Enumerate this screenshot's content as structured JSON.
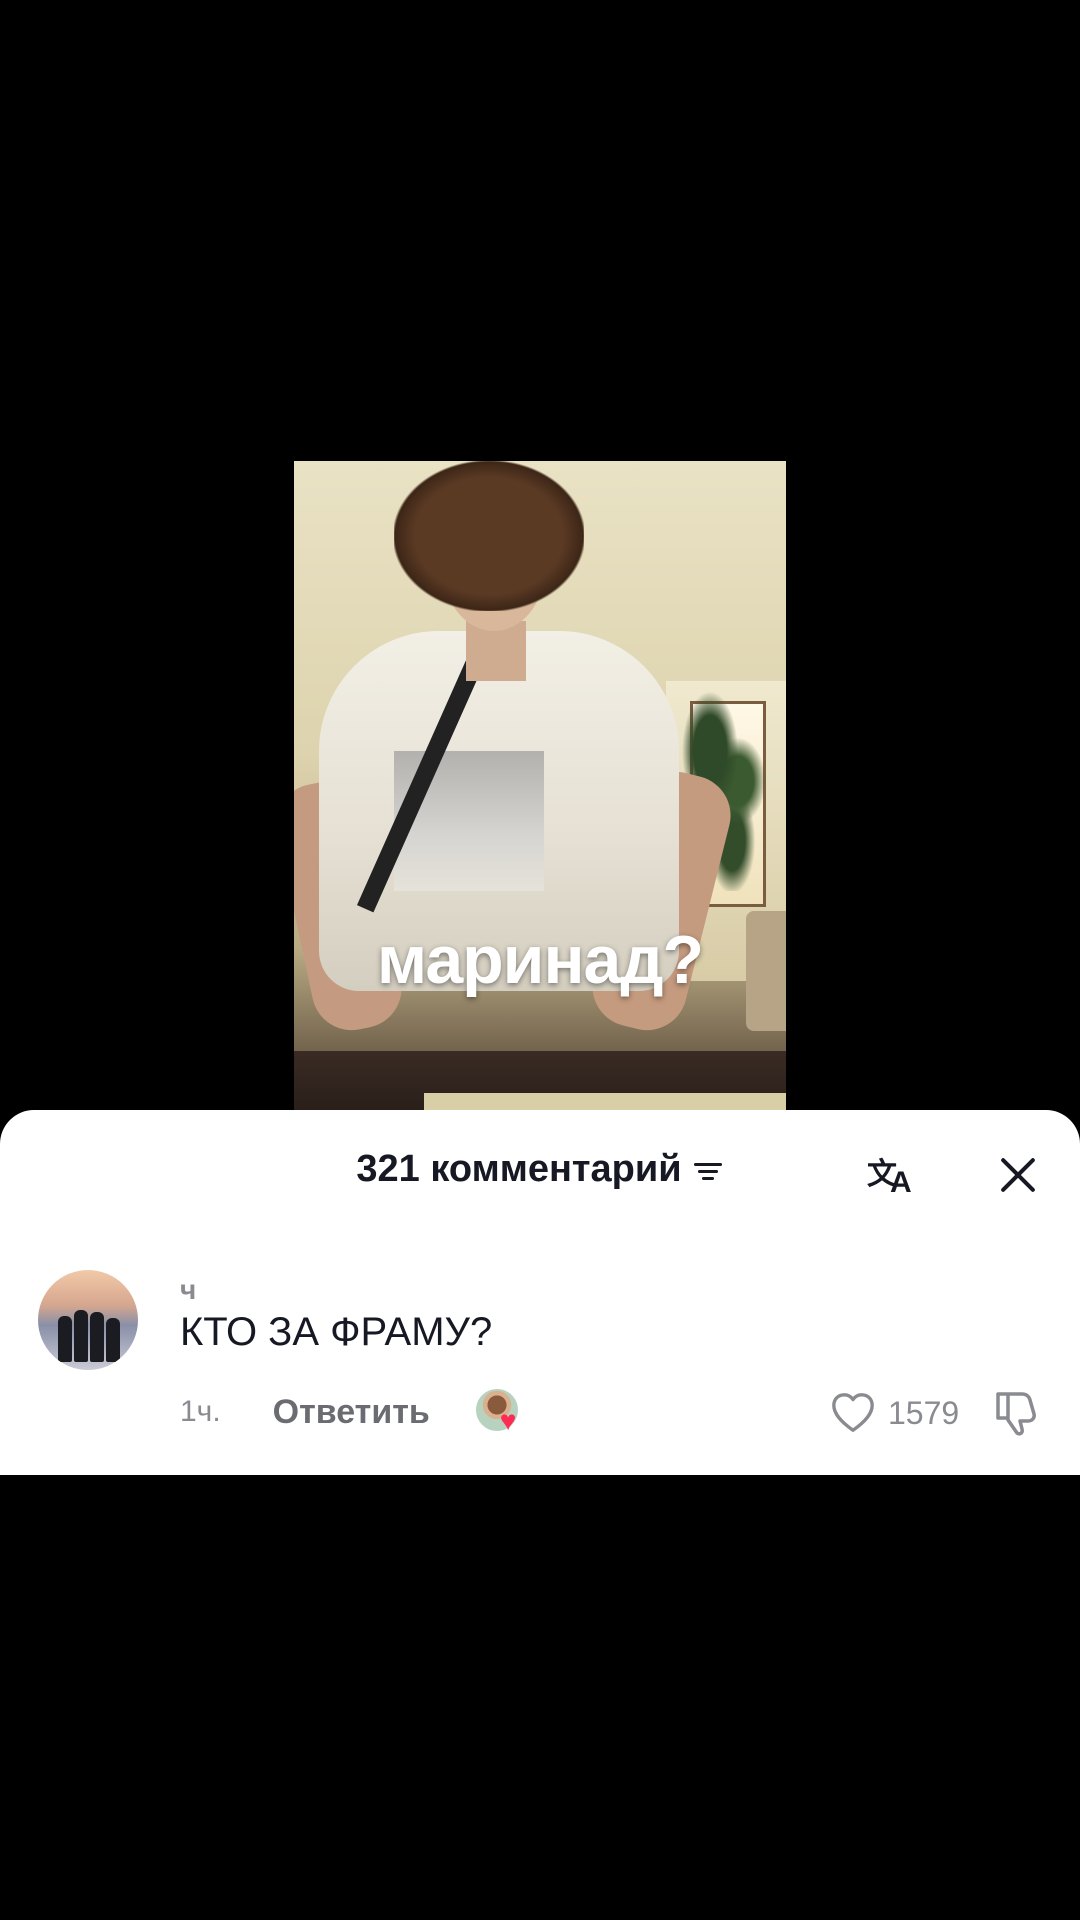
{
  "video": {
    "caption": "маринад?"
  },
  "comments_sheet": {
    "title": "321 комментарий",
    "icons": {
      "sort": "sort-icon",
      "translate": "translate-icon",
      "close": "close-icon"
    },
    "comments": [
      {
        "author": "ч",
        "text": "КТО ЗА ФРАМУ?",
        "time": "1ч.",
        "reply_label": "Ответить",
        "likes": "1579",
        "liked_by_creator": true
      }
    ]
  },
  "colors": {
    "text_primary": "#161823",
    "text_secondary": "#8a8b91",
    "like_red": "#fe2c55",
    "background": "#000000",
    "sheet": "#ffffff"
  }
}
